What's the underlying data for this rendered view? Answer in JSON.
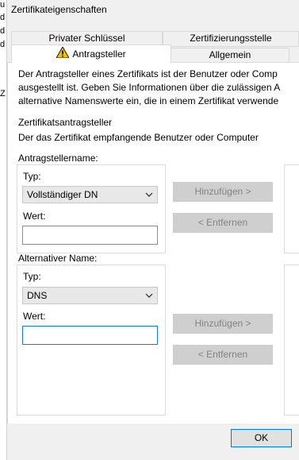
{
  "background_edge": [
    "u",
    "d",
    "d",
    "d",
    "Z"
  ],
  "window": {
    "title": "Zertifikateigenschaften"
  },
  "tabs": [
    {
      "label": "Privater Schlüssel",
      "active": false
    },
    {
      "label": "Zertifizierungsstelle",
      "active": false
    },
    {
      "label": "Antragsteller",
      "active": true,
      "icon": "warning-icon"
    },
    {
      "label": "Allgemein",
      "active": false
    }
  ],
  "description": [
    "Der Antragsteller eines Zertifikats ist der Benutzer oder Comp",
    "ausgestellt ist. Geben Sie Informationen über die zulässigen A",
    "alternative Namenswerte ein, die in einem Zertifikat verwende"
  ],
  "section": {
    "heading": "Zertifikatsantragsteller",
    "subheading": "Der das Zertifikat empfangende Benutzer oder Computer"
  },
  "subject_name": {
    "label": "Antragstellername:",
    "type_label": "Typ:",
    "type_value": "Vollständiger DN",
    "value_label": "Wert:",
    "value": "",
    "add_button": "Hinzufügen >",
    "remove_button": "< Entfernen"
  },
  "alternative_name": {
    "label": "Alternativer Name:",
    "type_label": "Typ:",
    "type_value": "DNS",
    "value_label": "Wert:",
    "value": "",
    "add_button": "Hinzufügen >",
    "remove_button": "< Entfernen"
  },
  "footer": {
    "ok_button": "OK"
  },
  "colors": {
    "focus_border": "#1979ca",
    "ok_border": "#0078d7",
    "warning": "#f4c000"
  }
}
